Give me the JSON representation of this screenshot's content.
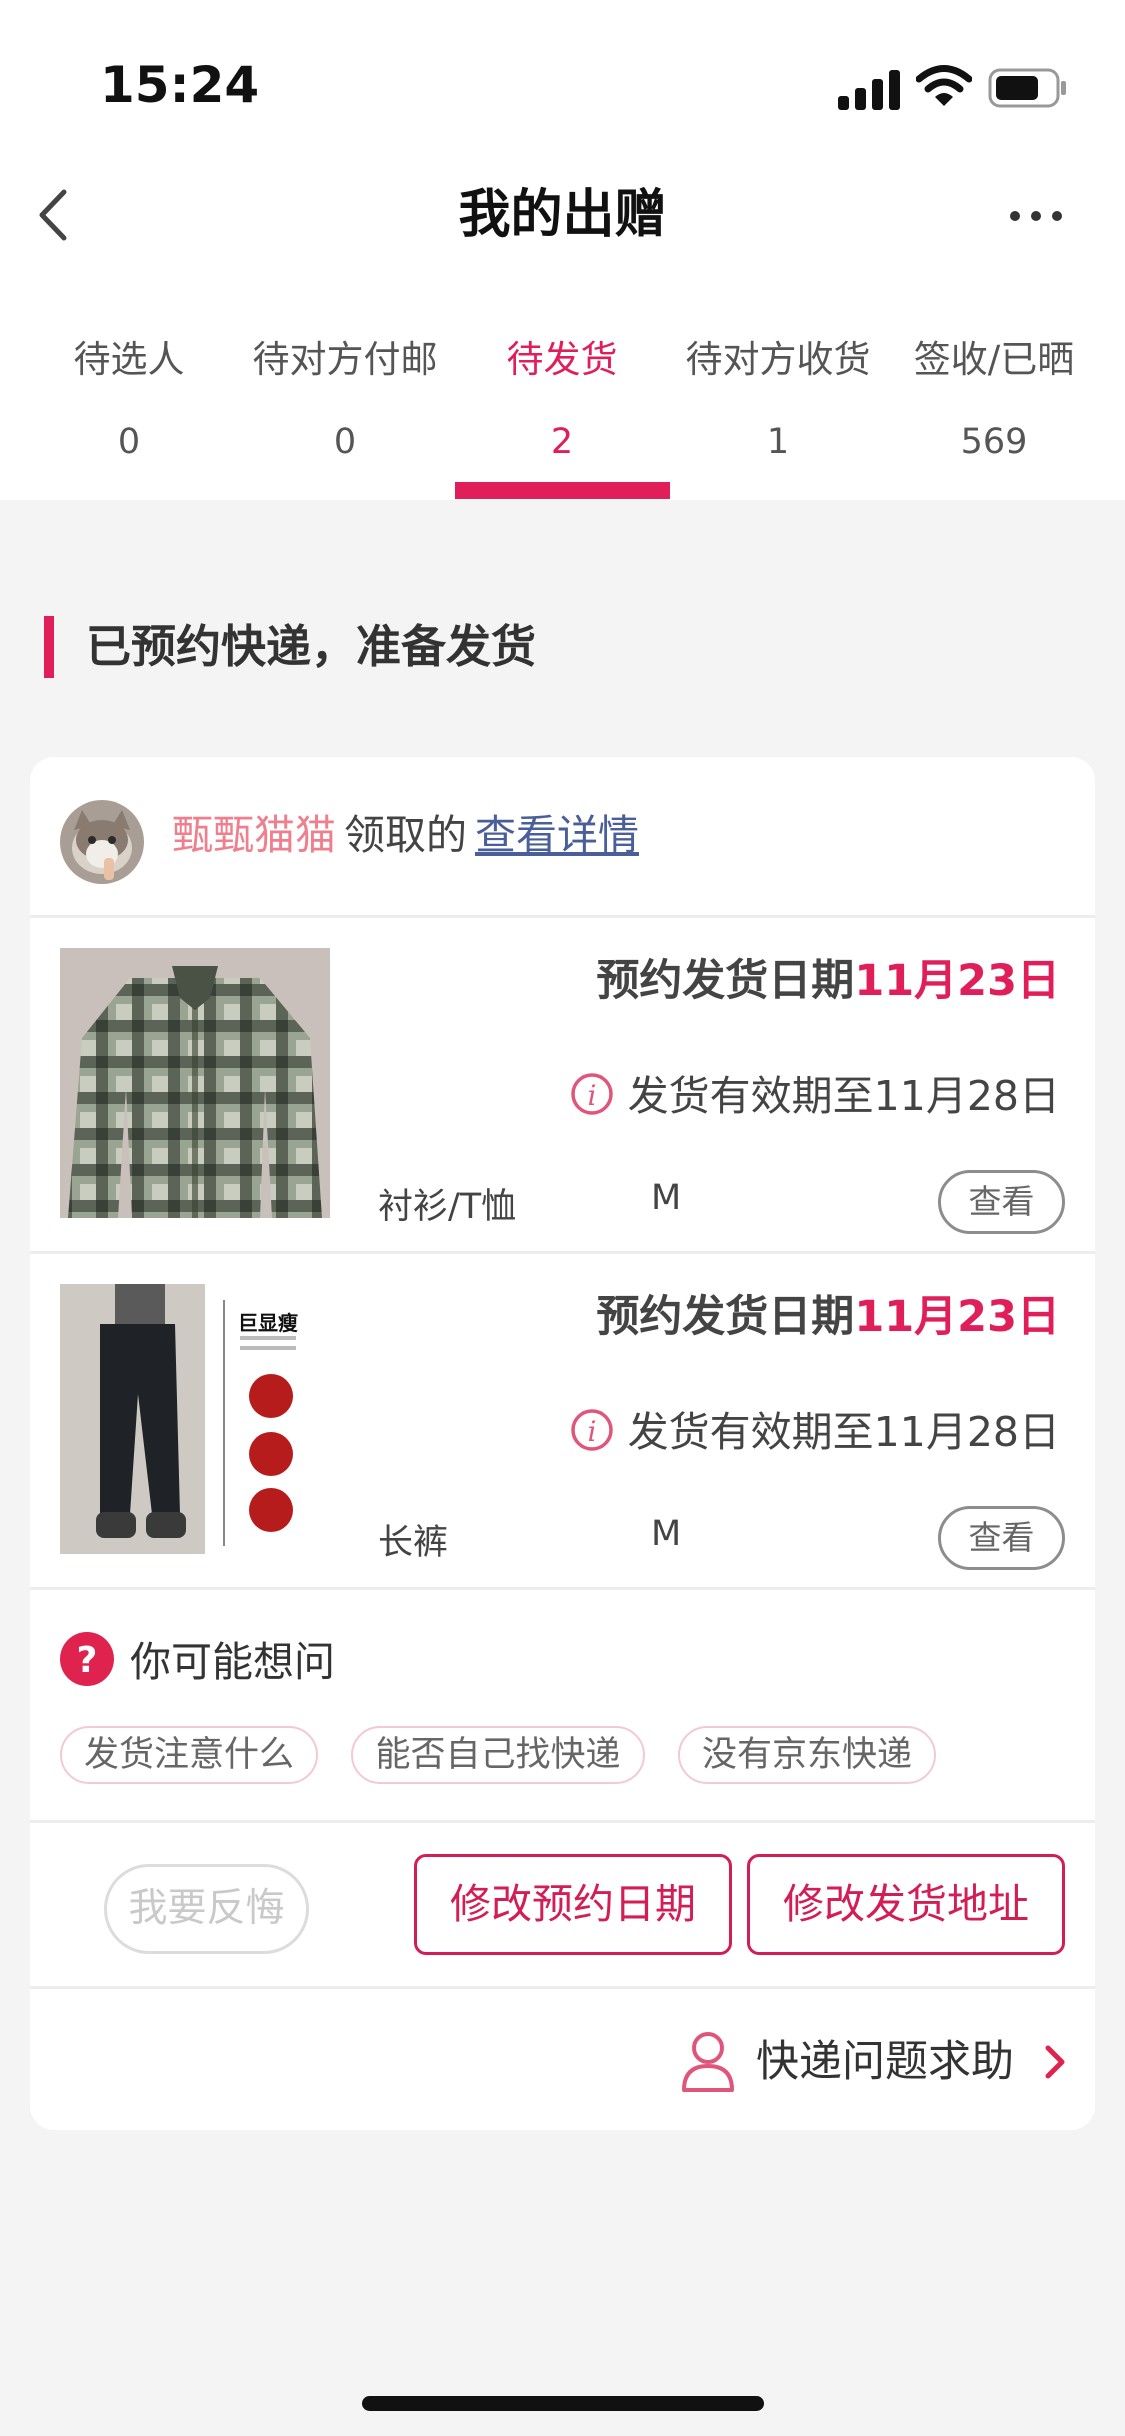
{
  "status_bar": {
    "time": "15:24"
  },
  "nav": {
    "title": "我的出赠",
    "back_icon": "chevron-left-icon",
    "more_icon": "ellipsis-icon"
  },
  "tabs": [
    {
      "label": "待选人",
      "count": "0"
    },
    {
      "label": "待对方付邮",
      "count": "0"
    },
    {
      "label": "待发货",
      "count": "2",
      "active": true
    },
    {
      "label": "待对方收货",
      "count": "1"
    },
    {
      "label": "签收/已晒",
      "count": "569"
    }
  ],
  "section": {
    "title": "已预约快递，准备发货"
  },
  "card": {
    "receiver_name": "甄甄猫猫",
    "receiver_action": "领取的",
    "detail_link": "查看详情",
    "items": [
      {
        "date_label": "预约发货日期",
        "date_value": "11月23日",
        "validity": "发货有效期至11月28日",
        "category": "衬衫/T恤",
        "size": "M",
        "view_label": "查看"
      },
      {
        "date_label": "预约发货日期",
        "date_value": "11月23日",
        "validity": "发货有效期至11月28日",
        "category": "长裤",
        "size": "M",
        "view_label": "查看",
        "image_caption": "巨显瘦"
      }
    ],
    "faq": {
      "title": "你可能想问",
      "chips": [
        "发货注意什么",
        "能否自己找快递",
        "没有京东快递"
      ]
    },
    "actions": {
      "regret": "我要反悔",
      "modify_date": "修改预约日期",
      "modify_address": "修改发货地址"
    },
    "help": {
      "label": "快递问题求助"
    }
  },
  "colors": {
    "accent": "#e01e5a",
    "receiver": "#ef7f8d",
    "link": "#4a5f9a",
    "background": "#f4f4f4"
  }
}
